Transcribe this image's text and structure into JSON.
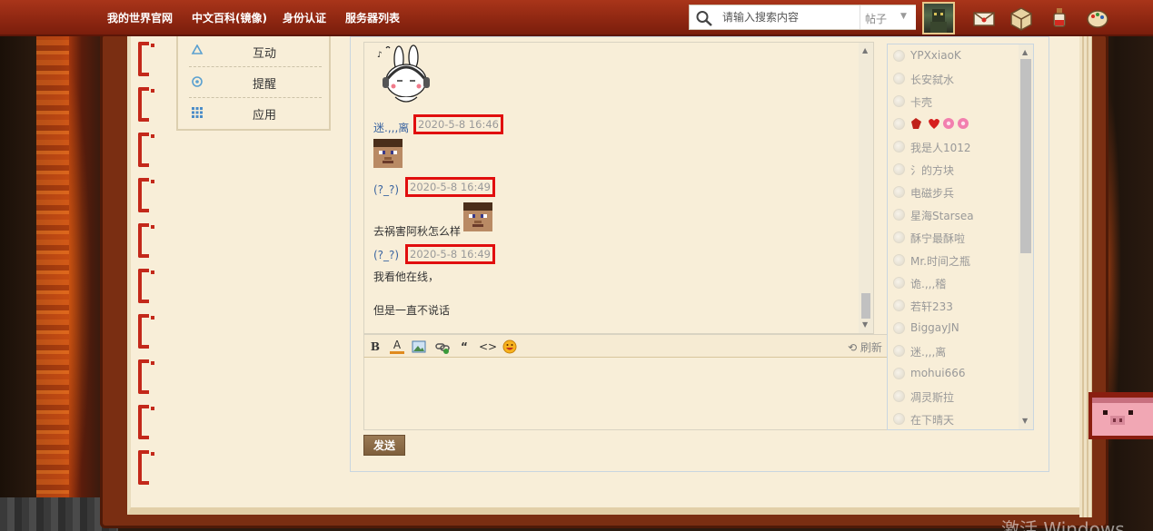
{
  "nav": {
    "links": [
      "我的世界官网",
      "中文百科(镜像)",
      "身份认证",
      "服务器列表"
    ],
    "search_placeholder": "请输入搜索内容",
    "search_type": "帖子"
  },
  "sidebar": {
    "items": [
      {
        "label": "互动",
        "icon": "recycle-icon"
      },
      {
        "label": "提醒",
        "icon": "bell-icon"
      },
      {
        "label": "应用",
        "icon": "apps-grid-icon"
      }
    ]
  },
  "chat": {
    "messages": [
      {
        "author": "迷.,,,离",
        "time": "2020-5-8 16:46",
        "content": "[steve-head emoji]"
      },
      {
        "author": "(?_?)",
        "time": "2020-5-8 16:49",
        "text": "去祸害阿秋怎么样"
      },
      {
        "author": "(?_?)",
        "time": "2020-5-8 16:49",
        "lines": [
          "我看他在线，",
          "但是一直不说话"
        ]
      }
    ],
    "refresh_label": "刷新",
    "send_label": "发送"
  },
  "users": [
    "YPXxiaoK",
    "长安弑水",
    "卡壳",
    "",
    "我是人1012",
    "氵的方块",
    "电磁步兵",
    "星海Starsea",
    "酥宁最酥啦",
    "Mr.时间之瓶",
    "诡.,,,稽",
    "若轩233",
    "BiggayJN",
    "迷.,,,离",
    "mohui666",
    "凋灵斯拉",
    "在下晴天"
  ],
  "watermark": "激活 Windows",
  "colors": {
    "nav_bg": "#8d2611",
    "highlight_box": "#e10e0e",
    "author_link": "#3a64a0",
    "send_button": "#8a6a46"
  }
}
